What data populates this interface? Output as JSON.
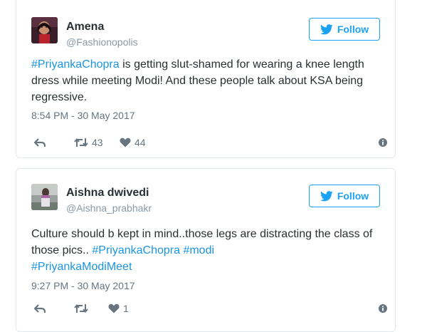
{
  "tweets": [
    {
      "name": "Amena",
      "handle": "@Fashionopolis",
      "follow_label": "Follow",
      "text_parts": [
        {
          "text": "#PriyankaChopra",
          "hashtag": true
        },
        {
          "text": " is getting slut-shamed for wearing a knee length dress while meeting Modi! And these people talk about KSA being regressive.",
          "hashtag": false
        }
      ],
      "timestamp": "8:54 PM - 30 May 2017",
      "retweets": "43",
      "likes": "44"
    },
    {
      "name": "Aishna dwivedi",
      "handle": "@Aishna_prabhakr",
      "follow_label": "Follow",
      "text_parts": [
        {
          "text": "Culture should b kept in mind..those legs are distracting the class of those pics.. ",
          "hashtag": false
        },
        {
          "text": "#PriyankaChopra",
          "hashtag": true
        },
        {
          "text": " ",
          "hashtag": false
        },
        {
          "text": "#modi",
          "hashtag": true
        },
        {
          "text": " ",
          "hashtag": false
        },
        {
          "text": "#PriyankaModiMeet",
          "hashtag": true
        }
      ],
      "timestamp": "9:27 PM - 30 May 2017",
      "retweets": "",
      "likes": "1"
    }
  ],
  "icons": {
    "bird": "twitter-bird-icon",
    "reply": "reply-icon",
    "retweet": "retweet-icon",
    "like": "heart-icon",
    "info": "info-icon"
  },
  "colors": {
    "accent": "#1da1f2",
    "hashtag": "#1b95e0",
    "muted": "#66757f",
    "border": "#e1e8ed"
  }
}
